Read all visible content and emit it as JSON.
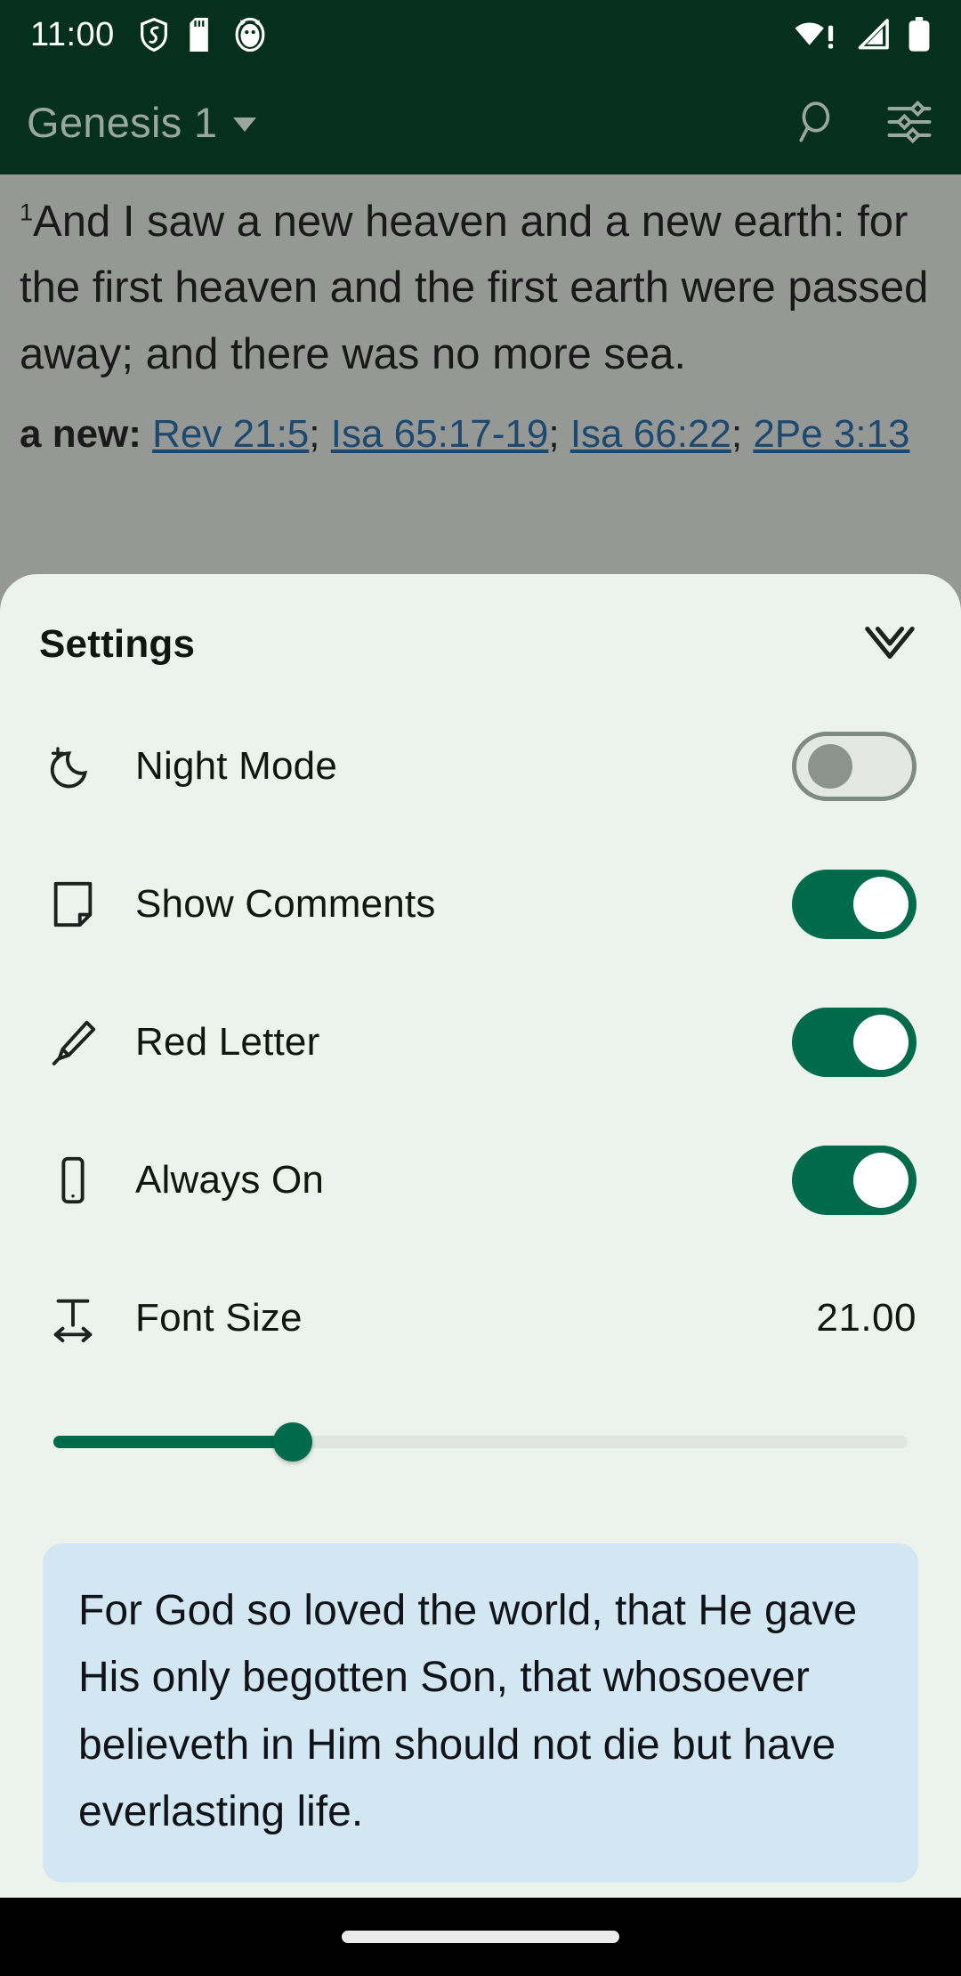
{
  "status_bar": {
    "clock": "11:00",
    "left_icons": [
      "shield-icon",
      "sd-card-icon",
      "cat-face-icon"
    ],
    "right_icons": [
      "wifi-no-internet-icon",
      "cellular-signal-icon",
      "battery-icon"
    ]
  },
  "app_bar": {
    "book_chapter": "Genesis 1",
    "dropdown_icon": "chevron-down-icon",
    "search_icon": "search-icon",
    "settings_icon": "sliders-icon"
  },
  "scripture": {
    "verse_number": "1",
    "verse_text": "And I saw a new heaven and a new earth: for the first heaven and the first earth were passed away; and there was no more sea.",
    "crossref_label": "a new:",
    "crossrefs": [
      "Rev 21:5",
      "Isa 65:17-19",
      "Isa 66:22",
      "2Pe 3:13"
    ]
  },
  "settings_sheet": {
    "title": "Settings",
    "collapse_icon": "double-chevron-down-icon",
    "rows": [
      {
        "label": "Night Mode",
        "icon": "moon-star-icon",
        "toggle": "off"
      },
      {
        "label": "Show Comments",
        "icon": "note-page-icon",
        "toggle": "on"
      },
      {
        "label": "Red Letter",
        "icon": "highlighter-icon",
        "toggle": "on"
      },
      {
        "label": "Always On",
        "icon": "smartphone-icon",
        "toggle": "on"
      }
    ],
    "font_size": {
      "label": "Font Size",
      "icon": "text-size-icon",
      "value": "21.00",
      "slider_percent": 28
    }
  },
  "verse_card": {
    "text": "For God so loved the world, that He gave His only begotten Son, that whosoever believeth in Him should not die but have everlasting life."
  },
  "nav_bar": {
    "gesture_pill": "home-gesture-pill"
  },
  "colors": {
    "header_green": "#05301d",
    "accent_green": "#006b4a",
    "sheet_bg": "#ecf2ec",
    "card_blue": "#d3e7f3",
    "link_blue": "#1565a8"
  }
}
